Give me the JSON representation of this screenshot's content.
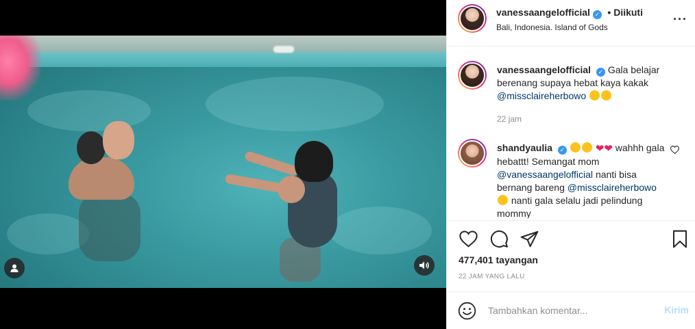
{
  "header": {
    "username": "vanessaangelofficial",
    "follow_status": "Diikuti",
    "location": "Bali, Indonesia. Island of Gods"
  },
  "caption": {
    "username": "vanessaangelofficial",
    "text_1": "Gala belajar berenang supaya hebat kaya kakak",
    "mention": "@missclaireherbowo",
    "time": "22 jam"
  },
  "comment": {
    "username": "shandyaulia",
    "text_1": "wahhh gala hebattt! Semangat mom",
    "mention_1": "@vanessaangelofficial",
    "text_2": "nanti bisa bernang bareng",
    "mention_2": "@missclaireherbowo",
    "text_3": "nanti gala selalu jadi pelindung mommy"
  },
  "stats": {
    "views": "477,401 tayangan",
    "time_ago": "22 JAM YANG LALU"
  },
  "comment_box": {
    "placeholder": "Tambahkan komentar...",
    "post_label": "Kirim"
  },
  "icons": {
    "more": "more-options-icon",
    "like": "heart-icon",
    "comment": "comment-icon",
    "share": "share-icon",
    "save": "bookmark-icon",
    "emoji": "emoji-icon",
    "user_tag": "user-tag-icon",
    "sound": "speaker-icon"
  },
  "colors": {
    "verified": "#3897f0",
    "mention": "#00376b",
    "post_button_disabled": "#b2dffc",
    "heart_emoji": "#e0245e"
  }
}
